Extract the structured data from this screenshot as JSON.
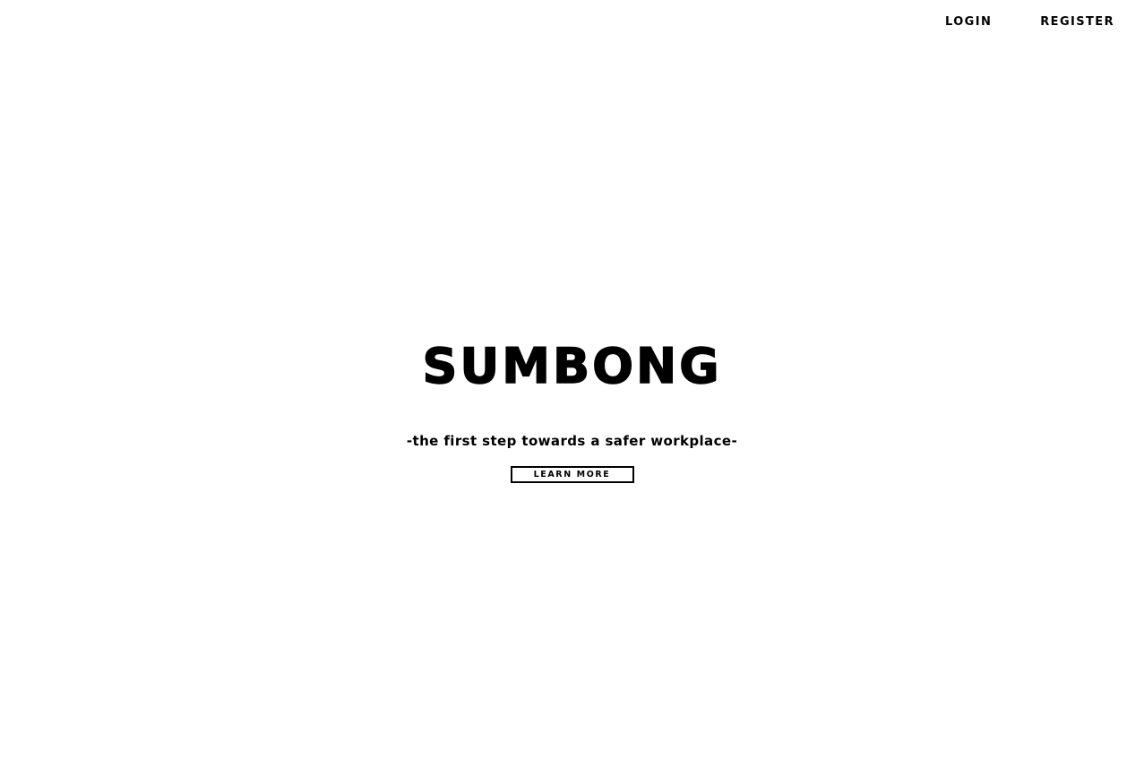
{
  "nav": {
    "login_label": "LOGIN",
    "register_label": "REGISTER"
  },
  "hero": {
    "title": "SUMBONG",
    "tagline": "-the first step towards a safer workplace-",
    "learn_more_label": "LEARN MORE"
  },
  "colors": {
    "background": "#ffffff",
    "text": "#000000"
  }
}
